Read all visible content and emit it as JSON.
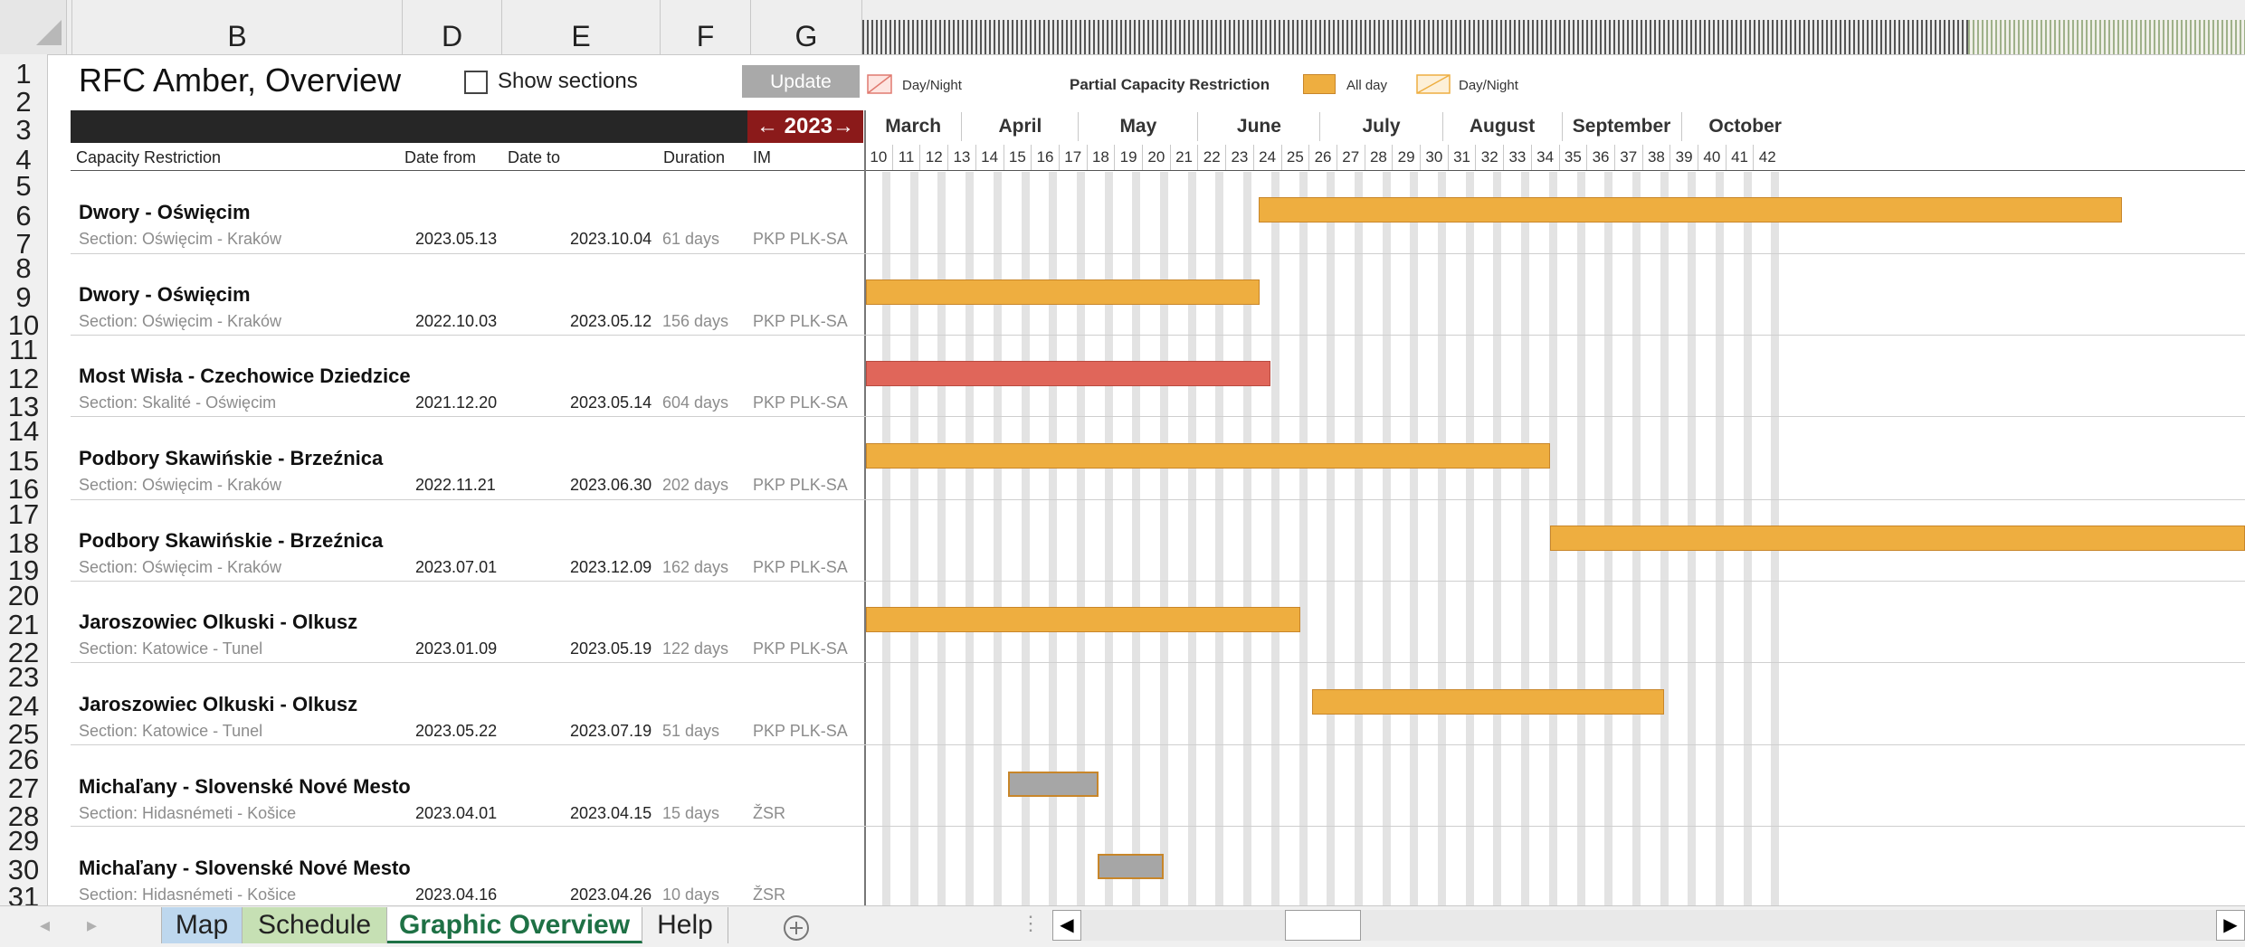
{
  "columns": [
    "B",
    "D",
    "E",
    "F",
    "G"
  ],
  "row_numbers": [
    "1",
    "2",
    "3",
    "4",
    "5",
    "6",
    "7",
    "8",
    "9",
    "10",
    "11",
    "12",
    "13",
    "14",
    "15",
    "16",
    "17",
    "18",
    "19",
    "20",
    "21",
    "22",
    "23",
    "24",
    "25",
    "26",
    "27",
    "28",
    "29",
    "30",
    "31"
  ],
  "header": {
    "title": "RFC Amber, Overview",
    "show_sections": "Show sections",
    "update_button": "Update",
    "year_nav": "← 2023→",
    "legend": {
      "day_night_1": "Day/Night",
      "title": "Partial Capacity Restriction",
      "all_day": "All day",
      "day_night_2": "Day/Night"
    },
    "table_headers": {
      "restriction": "Capacity Restriction",
      "date_from": "Date from",
      "date_to": "Date to",
      "duration": "Duration",
      "im": "IM"
    }
  },
  "timeline": {
    "months": [
      "March",
      "April",
      "May",
      "June",
      "July",
      "August",
      "September",
      "October"
    ],
    "weeks": [
      "10",
      "11",
      "12",
      "13",
      "14",
      "15",
      "16",
      "17",
      "18",
      "19",
      "20",
      "21",
      "22",
      "23",
      "24",
      "25",
      "26",
      "27",
      "28",
      "29",
      "30",
      "31",
      "32",
      "33",
      "34",
      "35",
      "36",
      "37",
      "38",
      "39",
      "40",
      "41",
      "42"
    ]
  },
  "restrictions": [
    {
      "title": "Dwory - Oświęcim",
      "section": "Section: Oświęcim - Kraków",
      "date_from": "2023.05.13",
      "date_to": "2023.10.04",
      "duration": "61 days",
      "im": "PKP PLK-SA",
      "bar_type": "all-day"
    },
    {
      "title": "Dwory - Oświęcim",
      "section": "Section: Oświęcim - Kraków",
      "date_from": "2022.10.03",
      "date_to": "2023.05.12",
      "duration": "156 days",
      "im": "PKP PLK-SA",
      "bar_type": "all-day"
    },
    {
      "title": "Most Wisła - Czechowice Dziedzice",
      "section": "Section: Skalité - Oświęcim",
      "date_from": "2021.12.20",
      "date_to": "2023.05.14",
      "duration": "604 days",
      "im": "PKP PLK-SA",
      "bar_type": "full-closure"
    },
    {
      "title": "Podbory Skawińskie - Brzeźnica",
      "section": "Section: Oświęcim - Kraków",
      "date_from": "2022.11.21",
      "date_to": "2023.06.30",
      "duration": "202 days",
      "im": "PKP PLK-SA",
      "bar_type": "all-day"
    },
    {
      "title": "Podbory Skawińskie - Brzeźnica",
      "section": "Section: Oświęcim - Kraków",
      "date_from": "2023.07.01",
      "date_to": "2023.12.09",
      "duration": "162 days",
      "im": "PKP PLK-SA",
      "bar_type": "all-day"
    },
    {
      "title": "Jaroszowiec Olkuski - Olkusz",
      "section": "Section: Katowice - Tunel",
      "date_from": "2023.01.09",
      "date_to": "2023.05.19",
      "duration": "122 days",
      "im": "PKP PLK-SA",
      "bar_type": "all-day"
    },
    {
      "title": "Jaroszowiec Olkuski - Olkusz",
      "section": "Section: Katowice - Tunel",
      "date_from": "2023.05.22",
      "date_to": "2023.07.19",
      "duration": "51 days",
      "im": "PKP PLK-SA",
      "bar_type": "all-day"
    },
    {
      "title": "Michaľany - Slovenské Nové Mesto",
      "section": "Section: Hidasnémeti - Košice",
      "date_from": "2023.04.01",
      "date_to": "2023.04.15",
      "duration": "15 days",
      "im": "ŽSR",
      "bar_type": "other"
    },
    {
      "title": "Michaľany - Slovenské Nové Mesto",
      "section": "Section: Hidasnémeti - Košice",
      "date_from": "2023.04.16",
      "date_to": "2023.04.26",
      "duration": "10 days",
      "im": "ŽSR",
      "bar_type": "other"
    }
  ],
  "sheet_tabs": [
    "Map",
    "Schedule",
    "Graphic Overview",
    "Help"
  ],
  "active_tab": "Graphic Overview",
  "colors": {
    "all_day": "#eeae40",
    "full_closure": "#e0665a",
    "other": "#a6a6a6",
    "year_nav_bg": "#8b1a1a",
    "active_tab_text": "#1e7145",
    "map_tab_bg": "#bdd7ee",
    "schedule_tab_bg": "#c6e0b4"
  }
}
